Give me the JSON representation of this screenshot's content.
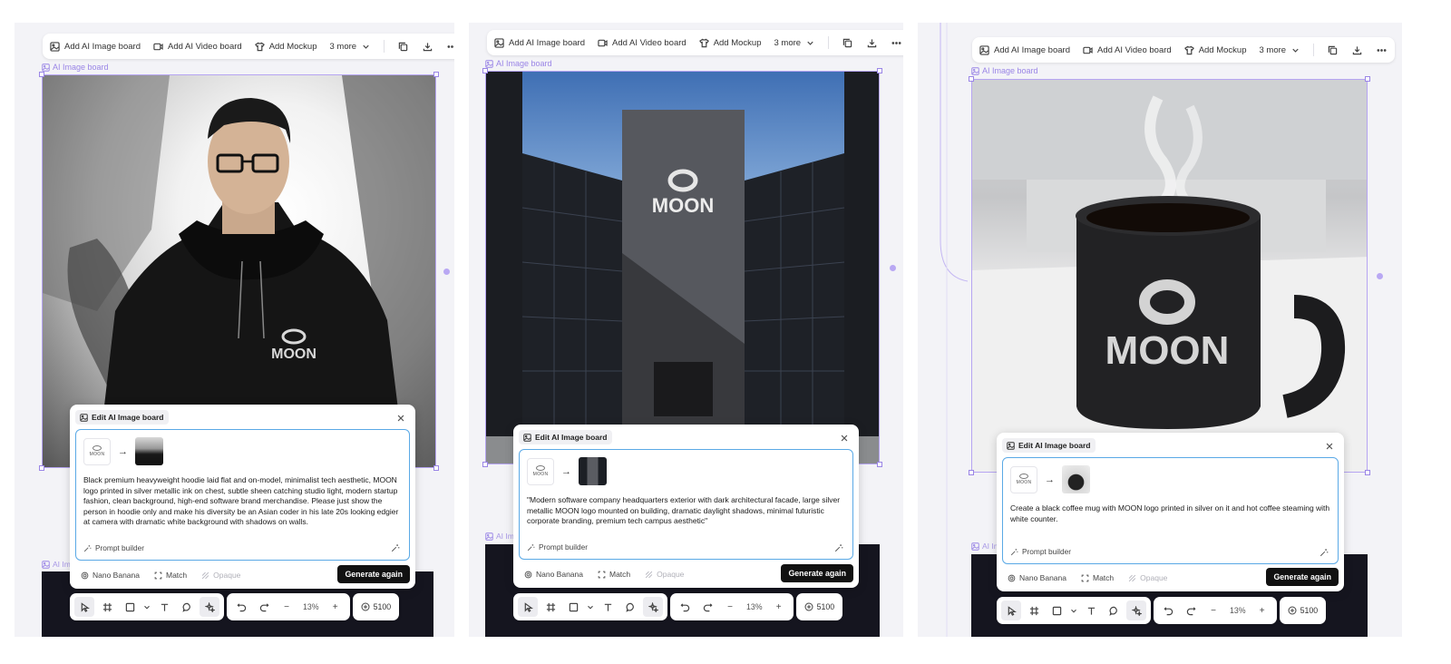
{
  "toolbar": {
    "add_image_label": "Add AI Image board",
    "add_video_label": "Add AI Video board",
    "add_mockup_label": "Add Mockup",
    "more_label": "3 more"
  },
  "board_label": "AI Image board",
  "board_label_cut": "AI Ima",
  "board_label_cut_short": "AI Im",
  "dialog": {
    "title": "Edit AI Image board",
    "prompt_builder": "Prompt builder",
    "model": "Nano Banana",
    "match": "Match",
    "opaque": "Opaque",
    "generate": "Generate again"
  },
  "logo_text": "MOON",
  "prompts": {
    "panel1": "Black premium heavyweight hoodie laid flat and on-model, minimalist tech aesthetic, MOON logo printed in silver metallic ink on chest, subtle sheen catching studio light, modern startup fashion, clean background, high-end software brand merchandise. Please just show the person in hoodie only and make his diversity be an Asian coder in his late 20s looking edgier at camera with dramatic white background with shadows on walls.",
    "panel2": "\"Modern software company headquarters exterior with dark architectural facade, large silver metallic MOON logo mounted on building, dramatic daylight shadows, minimal futuristic corporate branding, premium tech campus aesthetic\"",
    "panel3": "Create a black coffee mug with MOON logo printed in silver on it and hot coffee steaming with white counter."
  },
  "bottom": {
    "zoom": "13%",
    "credits": "5100",
    "minus": "−",
    "plus": "+"
  },
  "colors": {
    "canvas": "#f3f3f7",
    "selection": "#9a85e6",
    "input_focus": "#5aa9e6",
    "primary_button": "#111111"
  },
  "icons": [
    "image-board-icon",
    "video-board-icon",
    "mockup-icon",
    "chevron-down-icon",
    "duplicate-icon",
    "download-icon",
    "more-icon",
    "close-icon",
    "magic-wand-icon",
    "settings-icon",
    "match-icon",
    "opaque-icon",
    "pointer-icon",
    "frame-icon",
    "rectangle-icon",
    "text-icon",
    "comment-icon",
    "ai-sparkle-icon",
    "undo-icon",
    "redo-icon",
    "credits-icon"
  ]
}
